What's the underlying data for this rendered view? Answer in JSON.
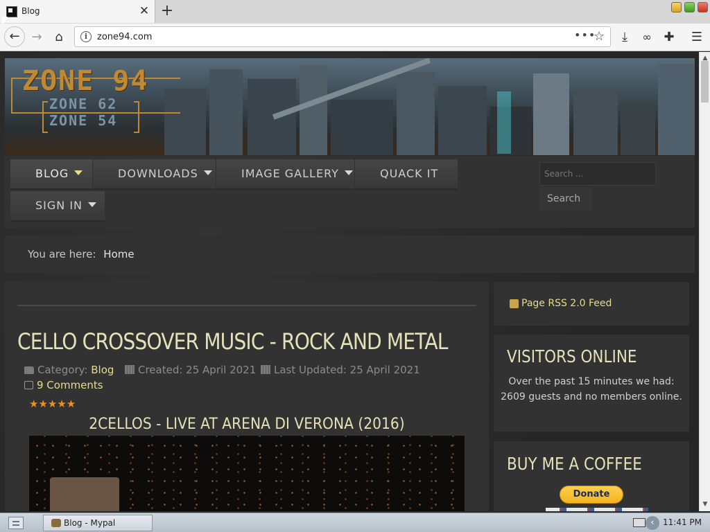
{
  "browser": {
    "tab_title": "Blog",
    "new_tab_label": "+",
    "close_tab_label": "✕",
    "url": "zone94.com",
    "page_actions_label": "•••"
  },
  "site": {
    "logo_main": "ZONE 94",
    "logo_sub_1": "ZONE 62",
    "logo_sub_2": "ZONE 54"
  },
  "nav": {
    "items": [
      {
        "label": "BLOG",
        "has_dropdown": true,
        "active": true
      },
      {
        "label": "DOWNLOADS",
        "has_dropdown": true
      },
      {
        "label": "IMAGE GALLERY",
        "has_dropdown": true
      },
      {
        "label": "QUACK IT",
        "has_dropdown": false
      },
      {
        "label": "SIGN IN",
        "has_dropdown": true
      }
    ],
    "search_placeholder": "Search ...",
    "search_button": "Search"
  },
  "breadcrumb": {
    "prefix": "You are here:",
    "current": "Home"
  },
  "article": {
    "title": "CELLO CROSSOVER MUSIC - ROCK AND METAL",
    "category_label": "Category:",
    "category": "Blog",
    "created": "Created: 25 April 2021",
    "updated": "Last Updated: 25 April 2021",
    "comments": "9 Comments",
    "rating": "★★★★★",
    "video_title": "2CELLOS - LIVE AT ARENA DI VERONA (2016)"
  },
  "sidebar": {
    "rss_label": "Page RSS 2.0 Feed",
    "visitors_title": "VISITORS ONLINE",
    "visitors_text": "Over the past 15 minutes we had: 2609 guests and no members online.",
    "coffee_title": "BUY ME A COFFEE",
    "donate_label": "Donate"
  },
  "taskbar": {
    "task_label": "Blog - Mypal",
    "clock": "11:41 PM"
  },
  "colors": {
    "accent_gold": "#e6dc8c",
    "title_cream": "#e4e0b8",
    "rating_orange": "#f0901c",
    "panel_bg": "#323232"
  }
}
